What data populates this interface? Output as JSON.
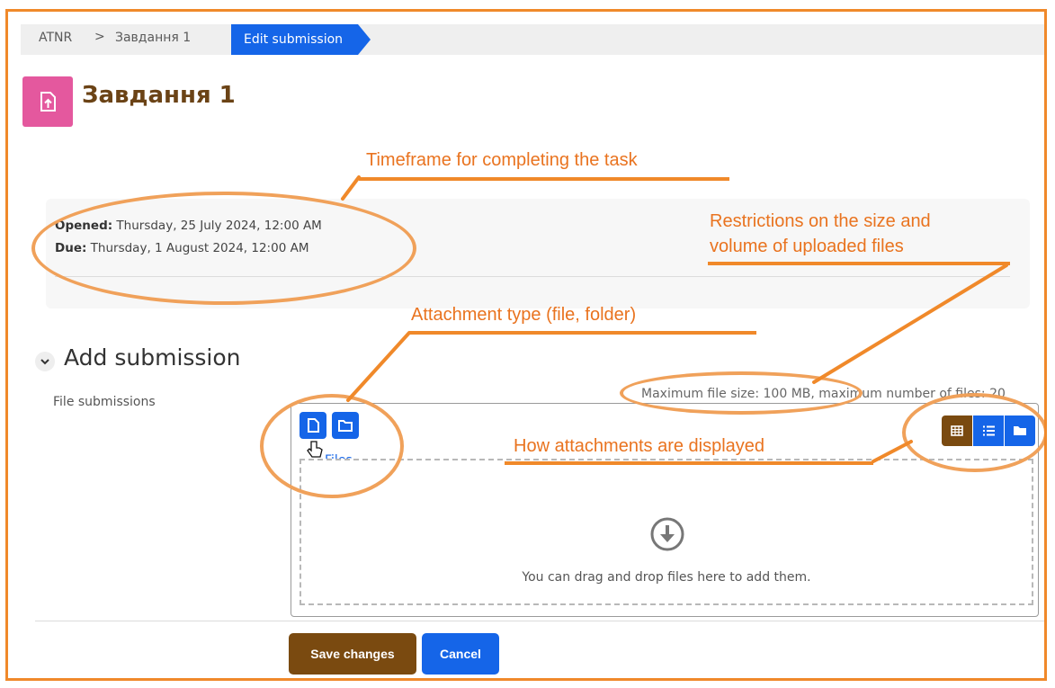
{
  "breadcrumb": {
    "items": [
      "ATNR",
      "Завдання 1"
    ],
    "separator": ">",
    "active": "Edit submission"
  },
  "page": {
    "title": "Завдання 1",
    "icon": "assignment-upload-icon"
  },
  "dates": {
    "opened_label": "Opened:",
    "opened_value": "Thursday, 25 July 2024, 12:00 AM",
    "due_label": "Due:",
    "due_value": "Thursday, 1 August 2024, 12:00 AM"
  },
  "submission": {
    "section_title": "Add submission",
    "field_label": "File submissions",
    "max_info": "Maximum file size: 100 MB, maximum number of files: 20",
    "files_path": "Files",
    "dropzone_text": "You can drag and drop files here to add them.",
    "picker_buttons": [
      "add-file-icon",
      "create-folder-icon"
    ],
    "view_buttons": [
      "grid-view-icon",
      "list-view-icon",
      "folder-tree-icon"
    ]
  },
  "actions": {
    "save": "Save changes",
    "cancel": "Cancel"
  },
  "callouts": {
    "timeframe": "Timeframe for completing the task",
    "restrictions_line1": "Restrictions on the size and",
    "restrictions_line2": "volume of uploaded files",
    "attachment_type": "Attachment type (file, folder)",
    "display": "How attachments are displayed"
  },
  "colors": {
    "primary": "#1565e8",
    "brown": "#7a4a10",
    "annotation": "#f0892a",
    "module_icon": "#e4589e"
  }
}
